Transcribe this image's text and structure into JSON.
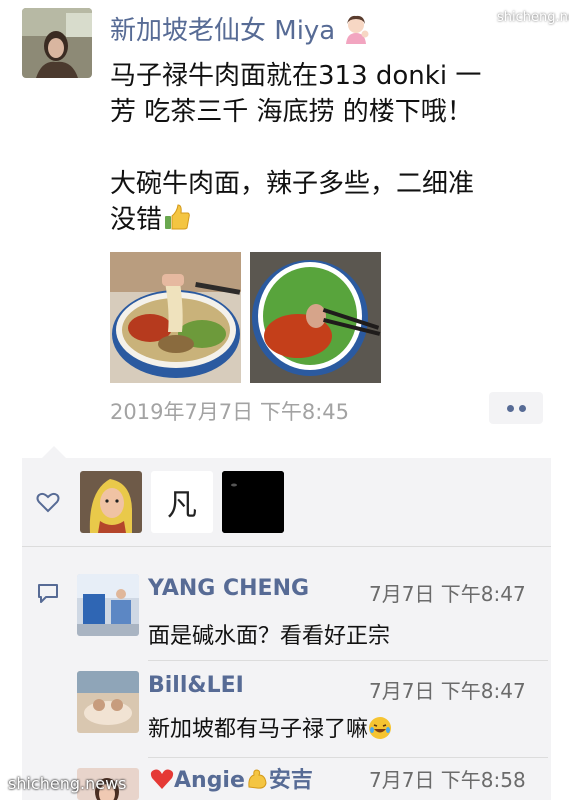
{
  "post": {
    "author": "新加坡老仙女 Miya",
    "author_emoji": "woman-tipping-hand-emoji",
    "text_lines": [
      "马子禄牛肉面就在313 donki 一",
      "芳 吃茶三千 海底捞 的楼下哦！",
      "",
      "大碗牛肉面，辣子多些，二细准",
      "没错"
    ],
    "thumb_emoji": "thumbs-up-emoji",
    "photos": [
      "beef-noodle-bowl-lifted-noodles",
      "beef-noodle-bowl-chili-oil"
    ],
    "timestamp": "2019年7月7日 下午8:45"
  },
  "likes": {
    "icon": "heart-outline-icon",
    "likers": [
      "cartoon-blonde-woman-avatar",
      "calligraphy-avatar",
      "black-avatar"
    ],
    "calligraphy_char": "凡"
  },
  "comments": {
    "icon": "comment-bubble-icon",
    "items": [
      {
        "name": "YANG CHENG",
        "time": "7月7日 下午8:47",
        "text": "面是碱水面？看看好正宗",
        "emoji": ""
      },
      {
        "name": "Bill&LEI",
        "time": "7月7日 下午8:47",
        "text": "新加坡都有马子禄了嘛",
        "emoji": "laughing-tears-emoji"
      },
      {
        "name": "Angie",
        "name_suffix": "安吉",
        "time": "7月7日 下午8:58",
        "text": "",
        "emoji": ""
      }
    ]
  },
  "watermark": "shicheng.news",
  "watermark_corner": "shicheng.news",
  "colors": {
    "name_blue": "#576b95",
    "panel_bg": "#f3f3f5",
    "timestamp_grey": "#a3a3a3"
  }
}
